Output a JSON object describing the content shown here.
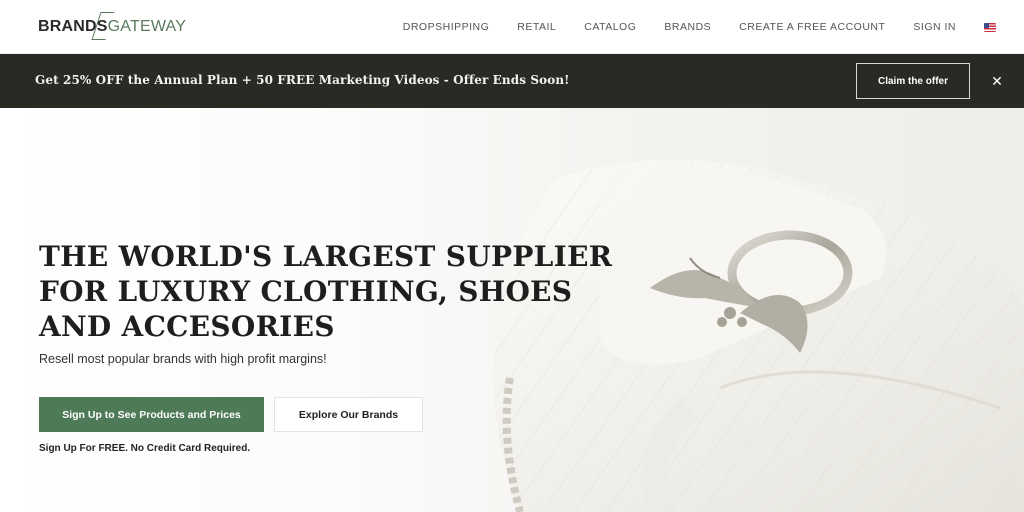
{
  "header": {
    "logo": {
      "part1": "BRANDS",
      "part2": "GATEWAY"
    },
    "nav": [
      {
        "label": "DROPSHIPPING"
      },
      {
        "label": "RETAIL"
      },
      {
        "label": "CATALOG"
      },
      {
        "label": "BRANDS"
      },
      {
        "label": "CREATE A FREE ACCOUNT"
      },
      {
        "label": "SIGN IN"
      }
    ],
    "flag_icon": "us-flag-icon"
  },
  "promo": {
    "text": "Get 25% OFF the Annual Plan + 50 FREE Marketing Videos - Offer Ends Soon!",
    "button_label": "Claim the offer",
    "close_symbol": "✕"
  },
  "hero": {
    "headline_lines": [
      "THE WORLD'S LARGEST SUPPLIER",
      "FOR LUXURY CLOTHING, SHOES",
      "AND ACCESORIES"
    ],
    "subline": "Resell most popular brands with high profit margins!",
    "primary_button": "Sign Up to See Products and Prices",
    "secondary_button": "Explore Our Brands",
    "note": "Sign Up For FREE. No Credit Card Required."
  },
  "colors": {
    "promo_bg": "#2a2a25",
    "accent_green": "#4f7a57",
    "logo_green": "#5a7a5e"
  }
}
